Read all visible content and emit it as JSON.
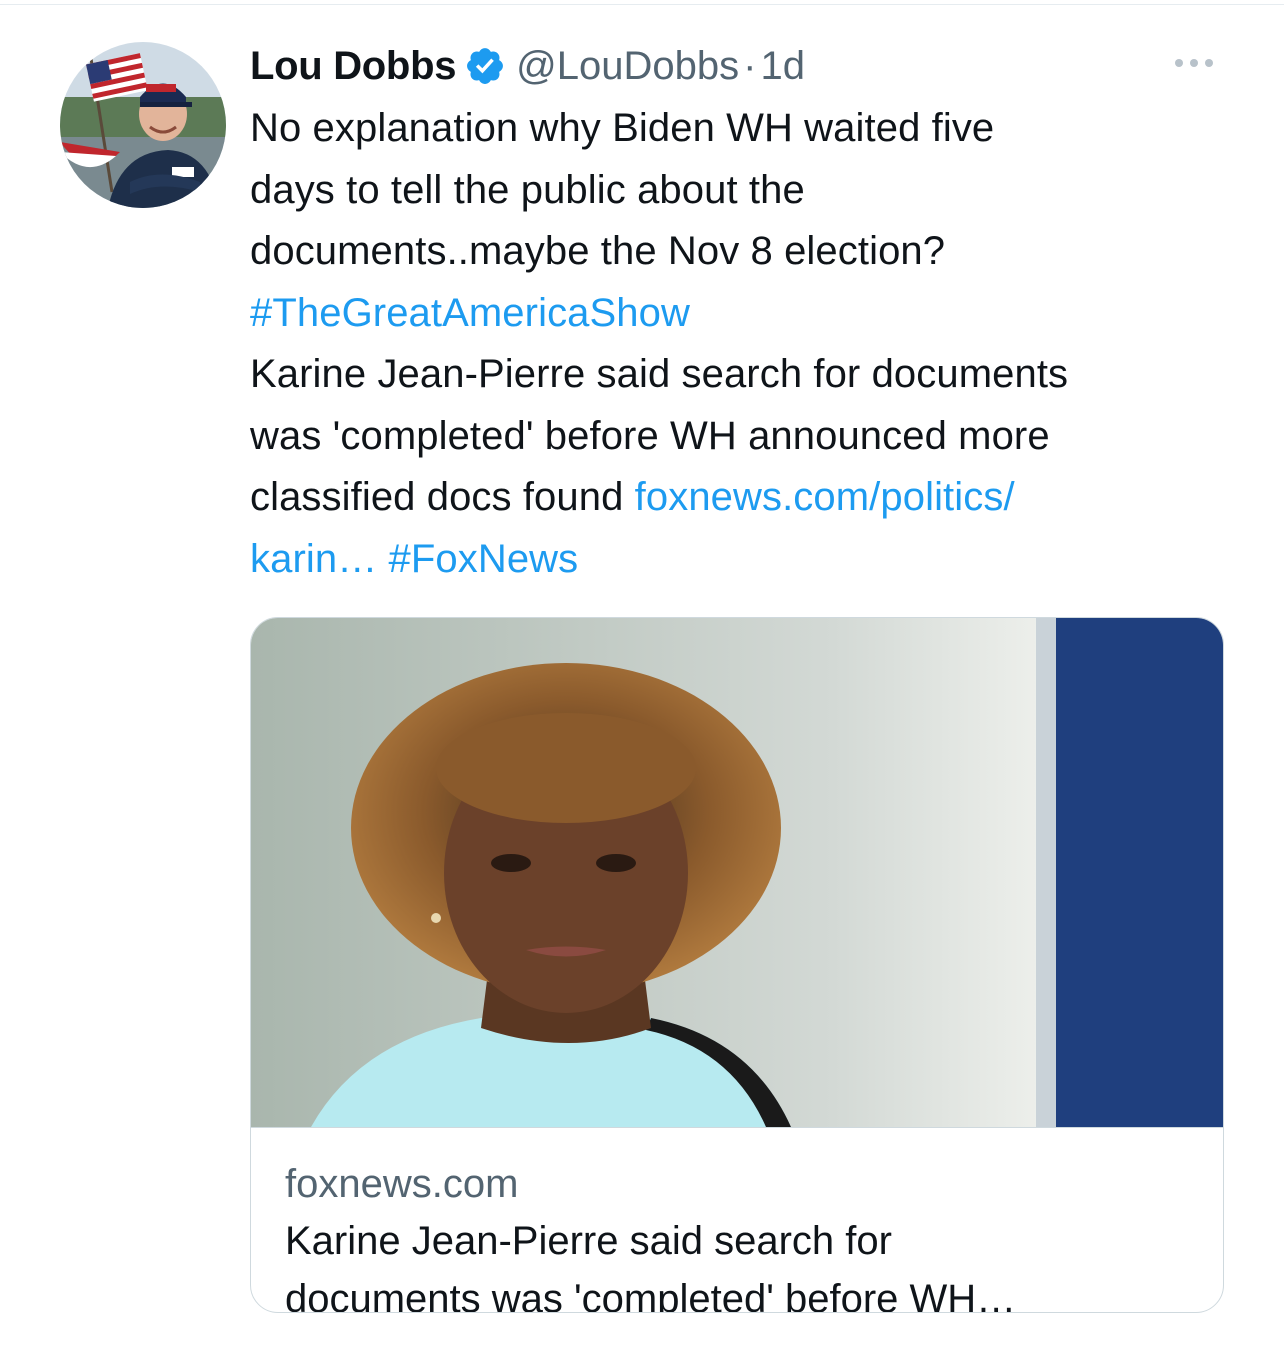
{
  "tweet": {
    "author": {
      "name": "Lou Dobbs",
      "handle": "@LouDobbs",
      "verified": true
    },
    "separator": "·",
    "time": "1d",
    "text_lines": [
      {
        "text": "No explanation why Biden WH waited five"
      },
      {
        "text": "days to tell the public about the"
      },
      {
        "text": "documents..maybe the Nov 8 election?"
      },
      {
        "link": "#TheGreatAmericaShow"
      },
      {
        "text": "Karine Jean-Pierre said search for documents"
      },
      {
        "text": "was 'completed' before WH announced more"
      },
      {
        "text": "classified docs found ",
        "link": "foxnews.com/politics/"
      },
      {
        "link": "karin… #FoxNews"
      }
    ],
    "card": {
      "domain": "foxnews.com",
      "title_lines": [
        "Karine Jean-Pierre said search for",
        "documents was 'completed' before WH…"
      ]
    }
  },
  "colors": {
    "text": "#0f1419",
    "secondary": "#536471",
    "link": "#1d9bf0",
    "border": "#cfd9de"
  },
  "icons": {
    "verified": "verified-badge-icon",
    "more": "more-dots-icon"
  }
}
